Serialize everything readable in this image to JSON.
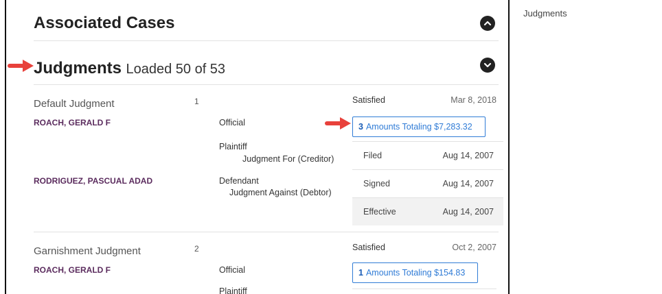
{
  "sidebar": {
    "link_label": "Judgments"
  },
  "associated_cases": {
    "title": "Associated Cases"
  },
  "judgments_section": {
    "title": "Judgments",
    "subtitle": "Loaded 50 of 53"
  },
  "colors": {
    "arrow": "#e8413b",
    "party": "#5b2c5e",
    "link": "#2f7bd6"
  },
  "judgments": [
    {
      "type": "Default Judgment",
      "number": "1",
      "status": "Satisfied",
      "status_date": "Mar 8, 2018",
      "amount_count": "3",
      "amount_text": "Amounts Totaling $7,283.32",
      "parties": [
        {
          "name": "ROACH, GERALD F",
          "role": "Official"
        },
        {
          "name": "",
          "role": "Plaintiff",
          "role_detail": "Judgment For (Creditor)"
        },
        {
          "name": "RODRIGUEZ, PASCUAL ADAD",
          "role": "Defendant",
          "role_detail": "Judgment Against (Debtor)"
        }
      ],
      "dates": [
        {
          "label": "Filed",
          "value": "Aug 14, 2007"
        },
        {
          "label": "Signed",
          "value": "Aug 14, 2007"
        },
        {
          "label": "Effective",
          "value": "Aug 14, 2007"
        }
      ]
    },
    {
      "type": "Garnishment Judgment",
      "number": "2",
      "status": "Satisfied",
      "status_date": "Oct 2, 2007",
      "amount_count": "1",
      "amount_text": "Amounts Totaling $154.83",
      "parties": [
        {
          "name": "ROACH, GERALD F",
          "role": "Official"
        },
        {
          "name": "",
          "role": "Plaintiff"
        }
      ]
    }
  ]
}
